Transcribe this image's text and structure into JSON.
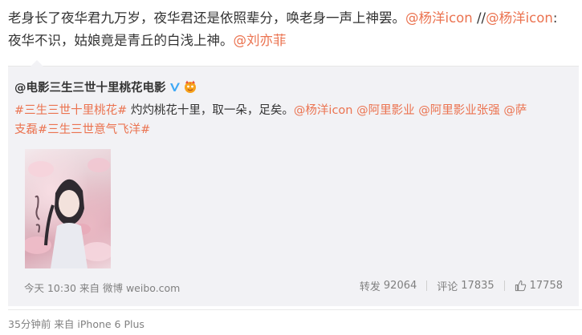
{
  "post": {
    "text_1": "老身长了夜华君九万岁，夜华君还是依照辈分，唤老身一声上神罢。",
    "mention_1": "@杨洋icon",
    "text_2": " //",
    "mention_2": "@杨洋icon",
    "text_3": ":夜华不识，姑娘竟是青丘的白浅上神。",
    "mention_3": "@刘亦菲"
  },
  "repost": {
    "author": "@电影三生三世十里桃花电影",
    "topic_1": "#三生三世十里桃花#",
    "text_1": " 灼灼桃花十里，取一朵，足矣。",
    "mention_1": "@杨洋icon",
    "mention_2": "@阿里影业",
    "mention_3": "@阿里影业张强",
    "mention_4": "@萨支磊",
    "topic_2": "#三生三世意气飞洋#",
    "footer": {
      "time": "今天 10:30 来自",
      "source": "微博 weibo.com",
      "repost_label": "转发",
      "repost_count": "92064",
      "comment_label": "评论",
      "comment_count": "17835",
      "like_count": "17758"
    }
  },
  "meta": {
    "time": "35分钟前",
    "from": "来自",
    "device": "iPhone 6 Plus"
  },
  "colors": {
    "link": "#eb7350",
    "repost_bg": "#f2f2f5",
    "verified": "#3fa9f5",
    "muted": "#808080"
  },
  "icons": [
    "verified-icon",
    "vip-icon",
    "thumb-up-icon"
  ]
}
